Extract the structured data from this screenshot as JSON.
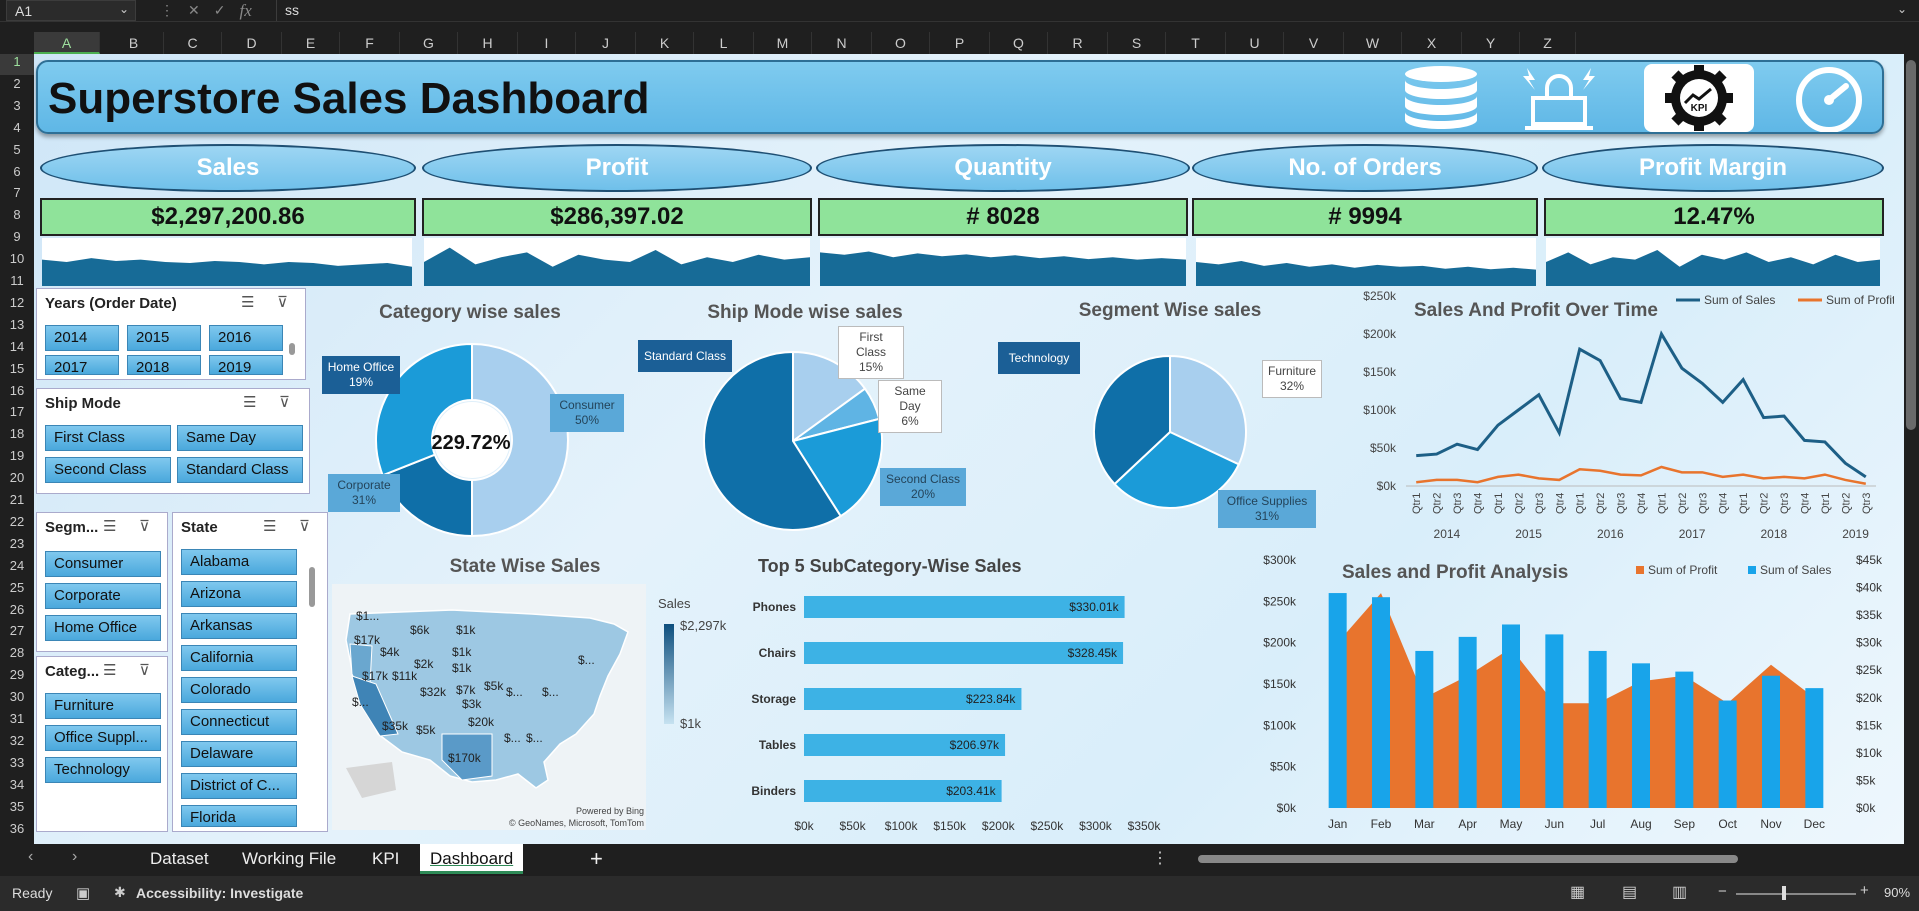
{
  "formula_bar": {
    "cell": "A1",
    "fx": "fx",
    "value": "ss"
  },
  "columns": [
    "A",
    "B",
    "C",
    "D",
    "E",
    "F",
    "G",
    "H",
    "I",
    "J",
    "K",
    "L",
    "M",
    "N",
    "O",
    "P",
    "Q",
    "R",
    "S",
    "T",
    "U",
    "V",
    "W",
    "X",
    "Y",
    "Z"
  ],
  "rows": [
    "1",
    "2",
    "3",
    "4",
    "5",
    "6",
    "7",
    "8",
    "9",
    "10",
    "11",
    "12",
    "13",
    "14",
    "15",
    "16",
    "17",
    "18",
    "19",
    "20",
    "21",
    "22",
    "23",
    "24",
    "25",
    "26",
    "27",
    "28",
    "29",
    "30",
    "31",
    "32",
    "33",
    "34",
    "35",
    "36"
  ],
  "dashboard": {
    "title": "Superstore Sales Dashboard",
    "icons": [
      "database-icon",
      "access-alert-icon",
      "kpi-gear-icon",
      "speedometer-icon"
    ],
    "kpis": [
      {
        "label": "Sales",
        "value": "$2,297,200.86",
        "spark": [
          0.55,
          0.5,
          0.58,
          0.52,
          0.55,
          0.5,
          0.48,
          0.52,
          0.5,
          0.45,
          0.5,
          0.48,
          0.42,
          0.45,
          0.48,
          0.4
        ]
      },
      {
        "label": "Profit",
        "value": "$286,397.02",
        "spark": [
          0.5,
          0.8,
          0.45,
          0.6,
          0.7,
          0.4,
          0.65,
          0.55,
          0.5,
          0.75,
          0.45,
          0.6,
          0.5,
          0.65,
          0.55,
          0.6
        ]
      },
      {
        "label": "Quantity",
        "value": "# 8028",
        "spark": [
          0.7,
          0.65,
          0.72,
          0.6,
          0.68,
          0.62,
          0.66,
          0.6,
          0.64,
          0.58,
          0.62,
          0.56,
          0.6,
          0.55,
          0.58,
          0.55
        ]
      },
      {
        "label": "No. of Orders",
        "value": "# 9994",
        "spark": [
          0.5,
          0.45,
          0.52,
          0.42,
          0.48,
          0.4,
          0.45,
          0.38,
          0.44,
          0.4,
          0.42,
          0.36,
          0.4,
          0.35,
          0.38,
          0.34
        ]
      },
      {
        "label": "Profit Margin",
        "value": "12.47%",
        "spark": [
          0.5,
          0.7,
          0.45,
          0.6,
          0.55,
          0.75,
          0.4,
          0.65,
          0.55,
          0.7,
          0.5,
          0.6,
          0.45,
          0.65,
          0.5,
          0.55
        ]
      }
    ]
  },
  "slicers": {
    "years": {
      "title": "Years (Order Date)",
      "items": [
        "2014",
        "2015",
        "2016",
        "2017",
        "2018",
        "2019"
      ]
    },
    "ship_mode": {
      "title": "Ship Mode",
      "items": [
        "First Class",
        "Same Day",
        "Second Class",
        "Standard Class"
      ]
    },
    "segment": {
      "title": "Segm...",
      "items": [
        "Consumer",
        "Corporate",
        "Home Office"
      ]
    },
    "category": {
      "title": "Categ...",
      "items": [
        "Furniture",
        "Office Suppl...",
        "Technology"
      ]
    },
    "state": {
      "title": "State",
      "items": [
        "Alabama",
        "Arizona",
        "Arkansas",
        "California",
        "Colorado",
        "Connecticut",
        "Delaware",
        "District of C...",
        "Florida"
      ]
    }
  },
  "colors": {
    "dark": "#0f6fa8",
    "mid": "#1b9bd8",
    "light": "#9fcde9",
    "orange": "#e8742d",
    "bar": "#3db2e5",
    "kpi_green": "#8fe39a"
  },
  "chart_data": [
    {
      "type": "pie",
      "title": "Category wise sales",
      "center_label": "229.72%",
      "labels": [
        "Consumer",
        "Home Office",
        "Corporate"
      ],
      "label_values": [
        "50%",
        "19%",
        "31%"
      ],
      "values": [
        50,
        19,
        31
      ]
    },
    {
      "type": "pie",
      "title": "Ship Mode wise sales",
      "labels": [
        "Standard Class",
        "First Class",
        "Same Day",
        "Second Class"
      ],
      "label_values": [
        "",
        "15%",
        "6%",
        "20%"
      ],
      "values": [
        59,
        15,
        6,
        20
      ]
    },
    {
      "type": "pie",
      "title": "Segment Wise sales",
      "labels": [
        "Furniture",
        "Office Supplies",
        "Technology"
      ],
      "label_values": [
        "32%",
        "31%",
        ""
      ],
      "values": [
        32,
        31,
        37
      ]
    },
    {
      "type": "line",
      "title": "Sales And Profit Over Time",
      "x": [
        "Qtr1",
        "Qtr2",
        "Qtr3",
        "Qtr4",
        "Qtr1",
        "Qtr2",
        "Qtr3",
        "Qtr4",
        "Qtr1",
        "Qtr2",
        "Qtr3",
        "Qtr4",
        "Qtr1",
        "Qtr2",
        "Qtr3",
        "Qtr4",
        "Qtr1",
        "Qtr2",
        "Qtr3",
        "Qtr4",
        "Qtr1",
        "Qtr2",
        "Qtr3"
      ],
      "years": [
        "2014",
        "2015",
        "2016",
        "2017",
        "2018",
        "2019"
      ],
      "yticks": [
        "$0k",
        "$50k",
        "$100k",
        "$150k",
        "$200k",
        "$250k"
      ],
      "ylim": [
        0,
        250000
      ],
      "series": [
        {
          "name": "Sum of Sales",
          "values": [
            40000,
            42000,
            55000,
            48000,
            80000,
            100000,
            120000,
            70000,
            180000,
            165000,
            115000,
            110000,
            200000,
            155000,
            135000,
            110000,
            140000,
            90000,
            92000,
            60000,
            58000,
            30000,
            12000
          ]
        },
        {
          "name": "Sum of Profit",
          "values": [
            5000,
            8000,
            8000,
            5000,
            12000,
            15000,
            10000,
            8000,
            22000,
            20000,
            15000,
            14000,
            25000,
            18000,
            18000,
            12000,
            15000,
            10000,
            12000,
            10000,
            15000,
            8000,
            3000
          ]
        }
      ]
    },
    {
      "type": "map",
      "title": "State Wise Sales",
      "legend_title": "Sales",
      "legend_max": "$2,297k",
      "legend_min": "$1k",
      "labels": [
        "$1...",
        "$17k",
        "$6k",
        "$1k",
        "$4k",
        "$1k",
        "$2k",
        "$1k",
        "$17k",
        "$11k",
        "$7k",
        "$5k",
        "$32k",
        "$3k",
        "$...",
        "$...",
        "$20k",
        "$35k",
        "$5k",
        "$...",
        "$...",
        "$170k",
        "$...",
        "$..."
      ],
      "credit1": "Powered by Bing",
      "credit2": "© GeoNames, Microsoft, TomTom"
    },
    {
      "type": "bar",
      "title": "Top 5 SubCategory-Wise Sales",
      "categories": [
        "Phones",
        "Chairs",
        "Storage",
        "Tables",
        "Binders"
      ],
      "values": [
        330010,
        328450,
        223840,
        206970,
        203410
      ],
      "data_labels": [
        "$330.01k",
        "$328.45k",
        "$223.84k",
        "$206.97k",
        "$203.41k"
      ],
      "xticks": [
        "$0k",
        "$50k",
        "$100k",
        "$150k",
        "$200k",
        "$250k",
        "$300k",
        "$350k"
      ],
      "xlim": [
        0,
        350000
      ]
    },
    {
      "type": "bar",
      "title": "Sales and Profit Analysis",
      "categories": [
        "Jan",
        "Feb",
        "Mar",
        "Apr",
        "May",
        "Jun",
        "Jul",
        "Aug",
        "Sep",
        "Oct",
        "Nov",
        "Dec"
      ],
      "yticks_left": [
        "$0k",
        "$50k",
        "$100k",
        "$150k",
        "$200k",
        "$250k",
        "$300k"
      ],
      "ylim_left": [
        0,
        300000
      ],
      "yticks_right": [
        "$0k",
        "$5k",
        "$10k",
        "$15k",
        "$20k",
        "$25k",
        "$30k",
        "$35k",
        "$40k",
        "$45k"
      ],
      "ylim_right": [
        0,
        45000
      ],
      "series": [
        {
          "name": "Sum of Profit",
          "axis": "right",
          "type": "area",
          "values": [
            30000,
            39000,
            20000,
            24000,
            29000,
            19000,
            19000,
            23000,
            24000,
            19000,
            26000,
            20000
          ]
        },
        {
          "name": "Sum of Sales",
          "axis": "left",
          "type": "bar",
          "values": [
            260000,
            255000,
            190000,
            207000,
            222000,
            210000,
            190000,
            175000,
            165000,
            130000,
            160000,
            145000
          ]
        }
      ]
    }
  ],
  "sheet_tabs": [
    "Dataset",
    "Working File",
    "KPI",
    "Dashboard"
  ],
  "active_tab": "Dashboard",
  "add_sheet": "+",
  "status": {
    "ready": "Ready",
    "accessibility": "Accessibility: Investigate",
    "zoom": "90%"
  }
}
